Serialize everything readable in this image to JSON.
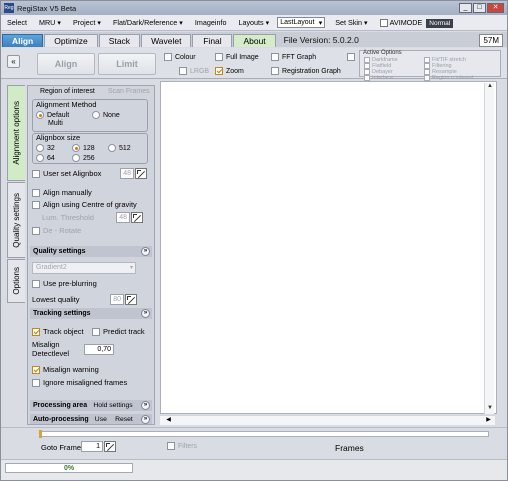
{
  "window": {
    "title": "RegiStax V5 Beta",
    "icon_text": "Reg",
    "minimize": "_",
    "maximize": "□",
    "close": "✕"
  },
  "menu": {
    "items": [
      "Select",
      "MRU",
      "Project",
      "Flat/Dark/Reference",
      "Imageinfo",
      "Layouts"
    ],
    "arrow": "▾",
    "layout_select": "LastLayout",
    "set_skin": "Set Skin",
    "avimode_label": "AVIMODE",
    "mode_badge": "Normal"
  },
  "tabs": {
    "items": [
      "Align",
      "Optimize",
      "Stack",
      "Wavelet",
      "Final",
      "About"
    ],
    "active": "Align",
    "file_version": "File Version: 5.0.2.0",
    "memory": "57M"
  },
  "toolbar": {
    "collapse": "«",
    "align_button": "Align",
    "limit_button": "Limit",
    "options": [
      {
        "label": "Colour",
        "checked": false,
        "enabled": true
      },
      {
        "label": "LRGB",
        "checked": false,
        "enabled": false
      },
      {
        "label": "Full Image",
        "checked": false,
        "enabled": true
      },
      {
        "label": "Zoom",
        "checked": true,
        "enabled": true
      },
      {
        "label": "FFT Graph",
        "checked": false,
        "enabled": true
      },
      {
        "label": "Registration Graph",
        "checked": false,
        "enabled": true
      }
    ],
    "active_options": {
      "caption": "Active Options",
      "items": [
        "Darkframe",
        "Fit/TIF stretch",
        "Flatfield",
        "Filtering",
        "Debayer",
        "Resample",
        "Interlace",
        "Region o interest"
      ]
    }
  },
  "side_tabs": [
    "Alignment options",
    "Quality settings",
    "Options"
  ],
  "alignment": {
    "region_of_interest": "Region of interest",
    "scan_frames": "Scan Frames",
    "method_title": "Alignment Method",
    "methods": [
      {
        "label": "Default",
        "selected": true
      },
      {
        "label": "None",
        "selected": false
      },
      {
        "label": "Multi",
        "selected": false
      }
    ],
    "alignbox_title": "Alignbox size",
    "sizes": [
      {
        "label": "32",
        "selected": false
      },
      {
        "label": "128",
        "selected": true
      },
      {
        "label": "512",
        "selected": false
      },
      {
        "label": "64",
        "selected": false
      },
      {
        "label": "256",
        "selected": false
      }
    ],
    "user_set": "User set Alignbox",
    "user_set_value": "48",
    "align_manually": "Align manually",
    "centre_gravity": "Align using Centre of gravity",
    "lum_threshold": "Lum. Threshold",
    "lum_value": "48",
    "de_rotate": "De - Rotate"
  },
  "quality": {
    "header": "Quality settings",
    "chevron": "»",
    "method": "Gradient2",
    "pre_blurring": "Use pre-blurring",
    "lowest_quality": "Lowest quality",
    "lowest_value": "80"
  },
  "tracking": {
    "header": "Tracking settings",
    "track_object": "Track object",
    "predict_track": "Predict track",
    "misalign_label_1": "Misalign",
    "misalign_label_2": "Detectlevel",
    "detect_value": "0,70",
    "misalign_warning": "Misalign warning",
    "ignore_misaligned": "Ignore misaligned frames"
  },
  "processing": {
    "header": "Processing area",
    "hold": "Hold settings"
  },
  "auto": {
    "header": "Auto-processing",
    "use": "Use",
    "reset": "Reset"
  },
  "framebar": {
    "goto_label": "Goto Frame",
    "goto_value": "1",
    "filters": "Filters",
    "frames_label": "Frames"
  },
  "status": {
    "progress": "0%",
    "progress_fraction": 0
  }
}
